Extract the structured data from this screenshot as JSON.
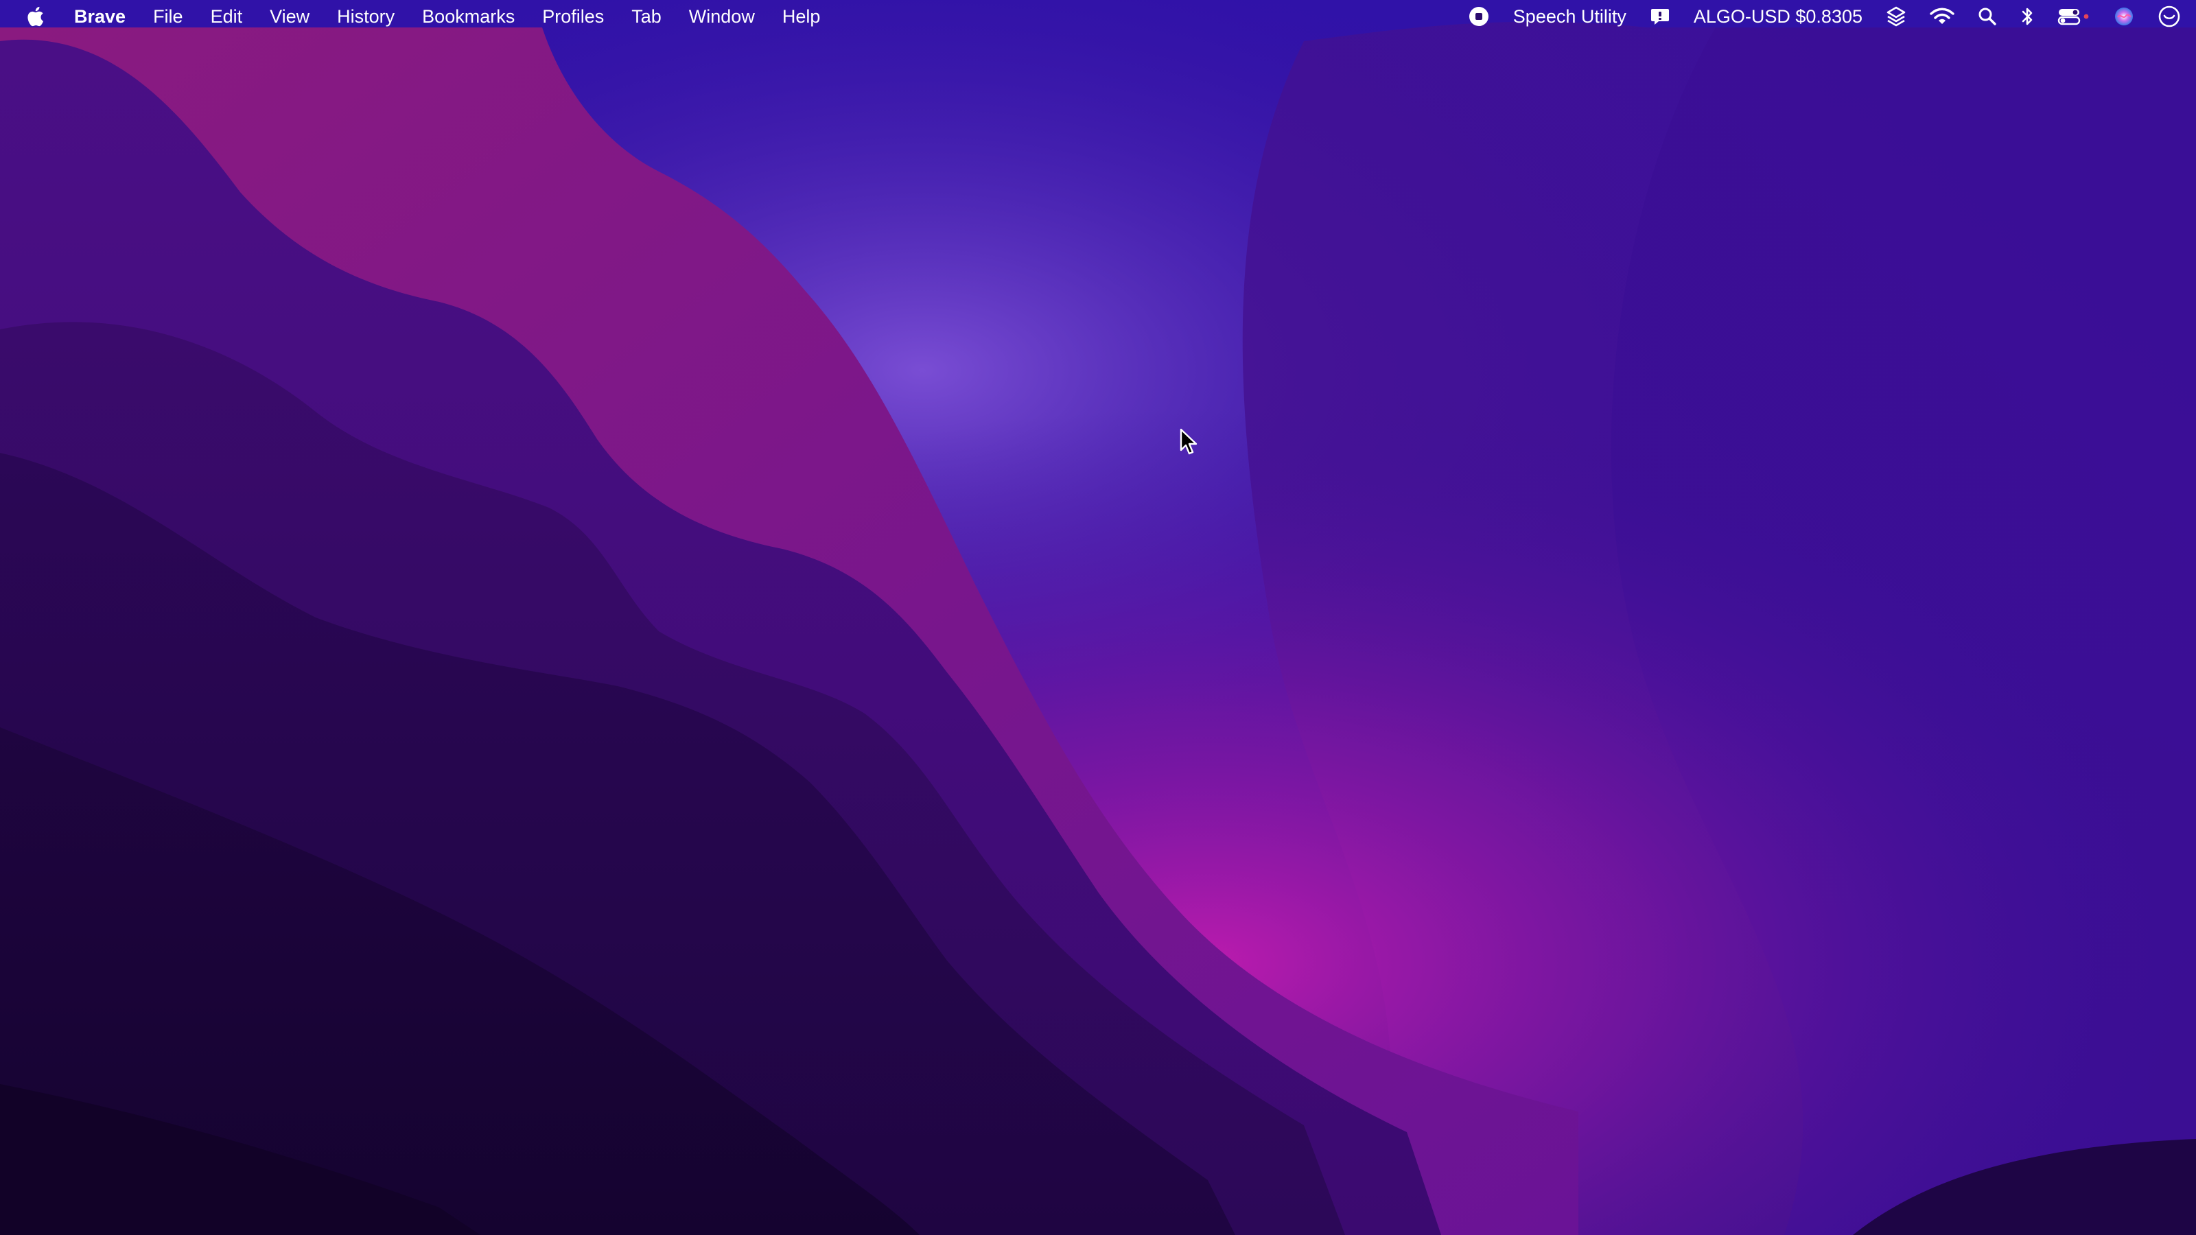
{
  "menubar": {
    "apple_icon": "apple-icon",
    "app_name": "Brave",
    "items": [
      {
        "label": "File"
      },
      {
        "label": "Edit"
      },
      {
        "label": "View"
      },
      {
        "label": "History"
      },
      {
        "label": "Bookmarks"
      },
      {
        "label": "Profiles"
      },
      {
        "label": "Tab"
      },
      {
        "label": "Window"
      },
      {
        "label": "Help"
      }
    ],
    "status": {
      "stop_icon": "stop-record-icon",
      "speech_utility_label": "Speech Utility",
      "chat_icon": "message-bubble-icon",
      "ticker_label": "ALGO-USD $0.8305",
      "layers_icon": "stack-icon",
      "wifi_icon": "wifi-icon",
      "search_icon": "search-icon",
      "bluetooth_icon": "bluetooth-icon",
      "control_center_icon": "control-center-icon",
      "siri_icon": "siri-icon",
      "notification_icon": "notification-center-icon"
    }
  },
  "colors": {
    "menubar_text": "#ffffff",
    "wallpaper_top": "#3a14b8",
    "wallpaper_mid": "#5b0d8c",
    "wallpaper_glow": "#b01aa8",
    "wallpaper_dark": "#1a0440"
  }
}
